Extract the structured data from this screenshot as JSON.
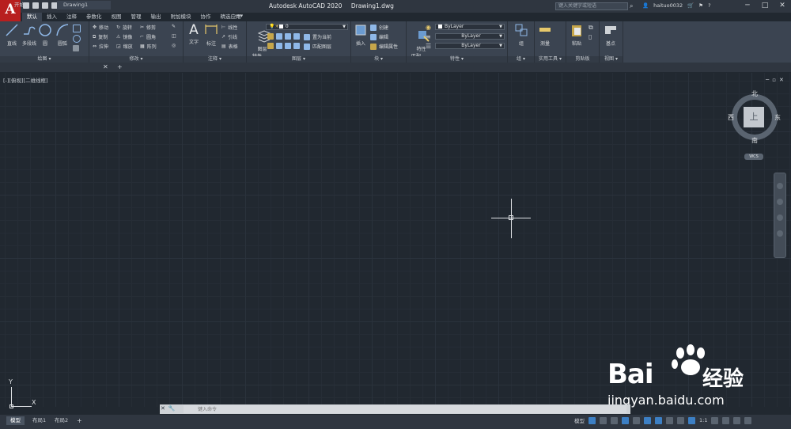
{
  "app": {
    "logo": "A",
    "title": "Autodesk AutoCAD 2020",
    "document": "Drawing1.dwg"
  },
  "search": {
    "placeholder": "键入关键字或短语"
  },
  "user": {
    "name": "haituo0032"
  },
  "ribbon_tabs": [
    "默认",
    "插入",
    "注释",
    "参数化",
    "视图",
    "管理",
    "输出",
    "附加模块",
    "协作",
    "精选应用"
  ],
  "ribbon": {
    "draw": {
      "title": "绘图",
      "line": "直线",
      "polyline": "多段线",
      "circle": "圆",
      "arc": "圆弧"
    },
    "modify": {
      "title": "修改",
      "move": "移动",
      "rotate": "旋转",
      "trim": "修剪",
      "copy": "复制",
      "mirror": "镜像",
      "fillet": "圆角",
      "stretch": "拉伸",
      "scale": "缩放",
      "array": "阵列"
    },
    "annotation": {
      "title": "注释",
      "text": "文字",
      "dimension": "标注",
      "linear": "线性",
      "leader": "引线",
      "table": "表格"
    },
    "layers": {
      "title": "图层",
      "layer_props": "图层\n特性",
      "current_layer": "0",
      "make_current": "置为当前",
      "match_layer": "匹配图层"
    },
    "block": {
      "title": "块",
      "insert": "插入",
      "create": "创建",
      "edit": "编辑",
      "edit_attr": "编辑属性"
    },
    "properties": {
      "title": "特性",
      "match": "特性\n匹配",
      "color": "ByLayer",
      "linetype": "ByLayer",
      "lineweight": "ByLayer"
    },
    "groups": {
      "title": "组",
      "group": "组"
    },
    "utilities": {
      "title": "实用工具",
      "measure": "测量"
    },
    "clipboard": {
      "title": "剪贴板",
      "paste": "粘贴"
    },
    "view": {
      "title": "视图",
      "base": "基点"
    }
  },
  "file_tabs": {
    "start": "开始",
    "drawing": "Drawing1"
  },
  "viewport": {
    "label": "[-][俯视][二维线框]"
  },
  "viewcube": {
    "north": "北",
    "south": "南",
    "east": "东",
    "west": "西",
    "face": "上",
    "wcs": "WCS"
  },
  "ucs": {
    "x": "X",
    "y": "Y"
  },
  "command": {
    "placeholder": "键入命令"
  },
  "layout_tabs": {
    "model": "模型",
    "layout1": "布局1",
    "layout2": "布局2"
  },
  "status": {
    "model": "模型",
    "scale": "1:1"
  },
  "watermark": {
    "brand": "Bai",
    "suffix": "经验",
    "url": "jingyan.baidu.com"
  },
  "colors": {
    "canvas": "#212830",
    "ribbon": "#3b4451",
    "logo": "#b81f1f",
    "accent": "#3c7fc4"
  }
}
